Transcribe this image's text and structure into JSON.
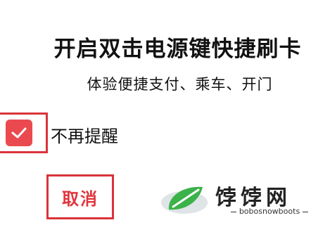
{
  "dialog": {
    "title": "开启双击电源键快捷刷卡",
    "subtitle": "体验便捷支付、乘车、开门",
    "checkbox": {
      "label": "不再提醒",
      "checked": true
    },
    "cancel_label": "取消"
  },
  "watermark": {
    "name": "饽饽网",
    "url": "bobosnowboots"
  },
  "colors": {
    "accent": "#ea4a4f",
    "highlight_frame": "#d9343b",
    "cancel_text": "#e0353d",
    "logo_green": "#3bb24a"
  }
}
